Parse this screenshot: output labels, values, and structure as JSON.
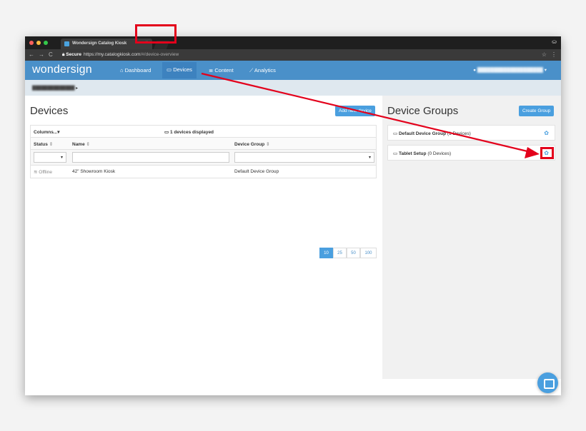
{
  "browser": {
    "tab_title": "Wondersign Catalog Kiosk",
    "tab_close": "×",
    "secure_label": "Secure",
    "url_host": "https://my.catalogkiosk.com",
    "url_path": "/#/device-overview",
    "back": "←",
    "forward": "→",
    "reload": "C"
  },
  "app": {
    "logo": "wondersign",
    "nav": {
      "dashboard": "Dashboard",
      "devices": "Devices",
      "content": "Content",
      "analytics": "Analytics"
    },
    "user_caret": "▾"
  },
  "devices": {
    "title": "Devices",
    "add_button": "Add new device",
    "columns_toggle": "Columns...",
    "displayed": "1 devices displayed",
    "headers": {
      "status": "Status",
      "name": "Name",
      "group": "Device Group"
    },
    "rows": [
      {
        "status": "Offline",
        "name": "42\" Showroom Kiosk",
        "group": "Default Device Group"
      }
    ],
    "page_sizes": [
      "10",
      "25",
      "50",
      "100"
    ],
    "active_page_size": "10"
  },
  "groups": {
    "title": "Device Groups",
    "create_button": "Create Group",
    "items": [
      {
        "name": "Default Device Group",
        "count": "(1 Devices)"
      },
      {
        "name": "Tablet Setup",
        "count": "(0 Devices)"
      }
    ]
  },
  "colors": {
    "primary": "#4a90c9",
    "button": "#4a9fdf",
    "annotation": "#e3001b"
  }
}
